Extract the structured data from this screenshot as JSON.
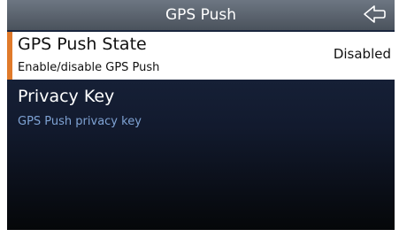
{
  "header": {
    "title": "GPS Push"
  },
  "items": [
    {
      "title": "GPS Push State",
      "subtitle": "Enable/disable GPS Push",
      "value": "Disabled",
      "selected": true
    },
    {
      "title": "Privacy Key",
      "subtitle": "GPS Push privacy key",
      "value": "",
      "selected": false
    }
  ],
  "colors": {
    "accent": "#e07a2a",
    "subtitle": "#7fa3d4",
    "selected_bg": "#ffffff"
  },
  "icons": {
    "back": "back-arrow-icon"
  }
}
